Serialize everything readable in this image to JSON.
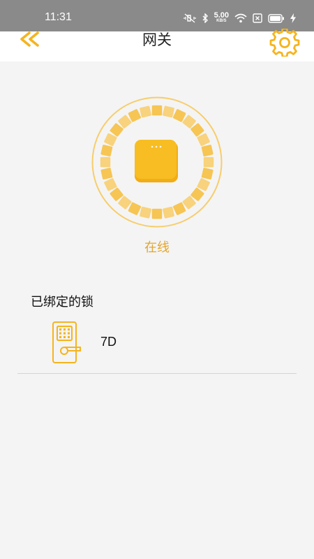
{
  "status_bar": {
    "time": "11:31",
    "net_speed": "5.00",
    "net_speed_unit": "KB/S",
    "icons": [
      "mute-vibrate-icon",
      "bluetooth-icon",
      "wifi-icon",
      "sim-x-icon",
      "battery-icon",
      "charging-icon"
    ]
  },
  "header": {
    "title": "网关",
    "back_icon": "double-chevron-left-icon",
    "settings_icon": "gear-icon"
  },
  "gateway": {
    "status": "在线"
  },
  "locks_section": {
    "title": "已绑定的锁",
    "items": [
      {
        "name": "7D",
        "icon": "door-lock-icon"
      }
    ]
  },
  "colors": {
    "accent": "#f5b41e",
    "accent_light": "#f7cd6b",
    "status_text": "#e5a52a",
    "background": "#f4f4f4",
    "header_bg": "#ffffff",
    "status_bar_bg": "#8a8a8a"
  }
}
